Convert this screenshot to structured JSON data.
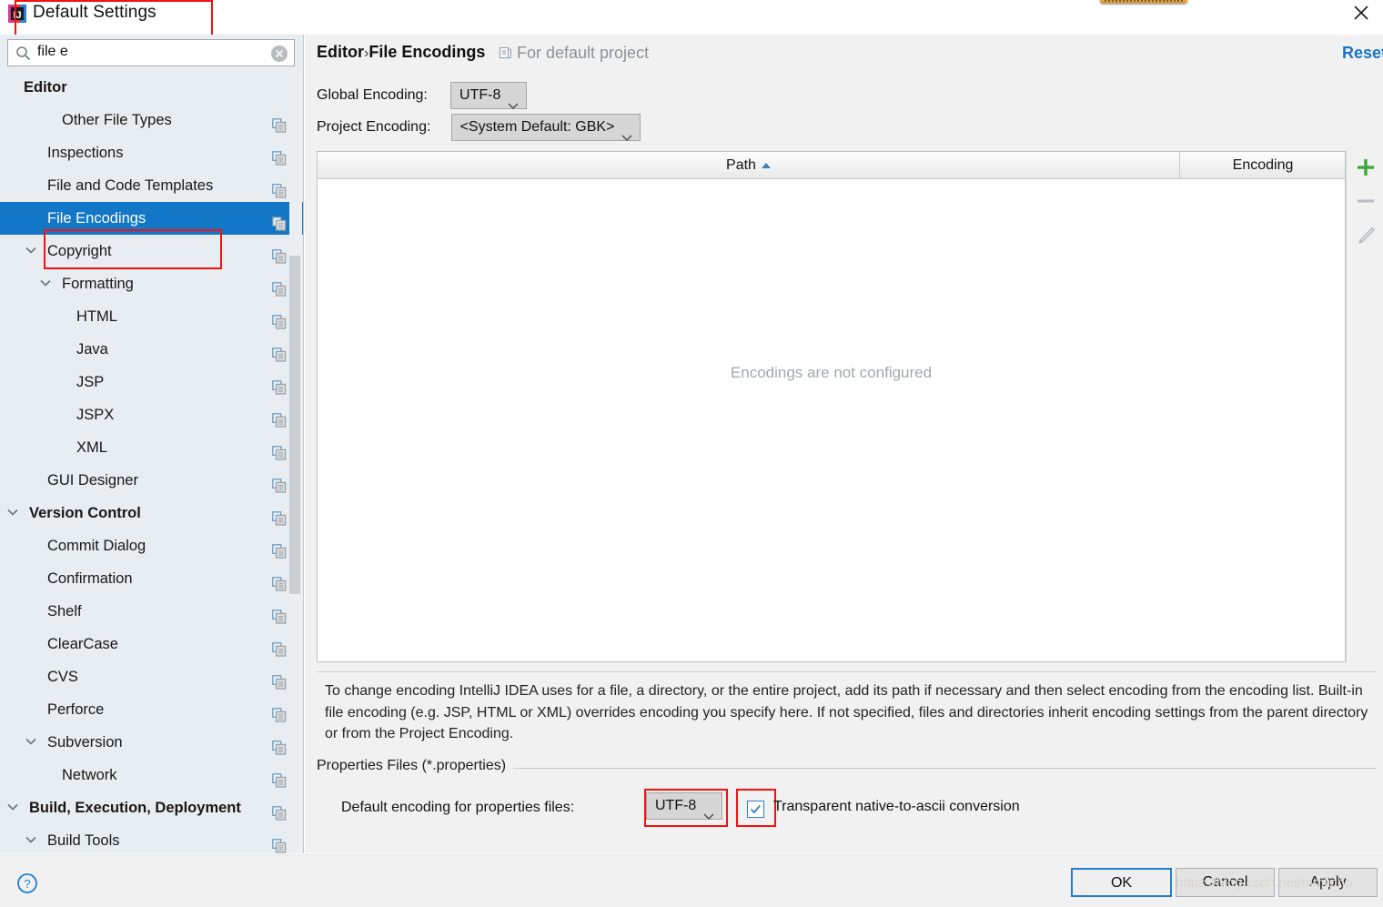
{
  "window": {
    "title": "Default Settings",
    "app_icon": "intellij-idea-icon",
    "close_icon": "close-icon"
  },
  "search": {
    "value": "file e",
    "placeholder": "",
    "icon": "search-icon",
    "clear_icon": "clear-icon"
  },
  "sidebar": {
    "items": [
      {
        "label": "Editor",
        "indent": 26,
        "bold": true,
        "chevron": "none",
        "selected": false,
        "copy": false
      },
      {
        "label": "Other File Types",
        "indent": 68,
        "bold": false,
        "chevron": "none",
        "selected": false,
        "copy": true
      },
      {
        "label": "Inspections",
        "indent": 52,
        "bold": false,
        "chevron": "none",
        "selected": false,
        "copy": true
      },
      {
        "label": "File and Code Templates",
        "indent": 52,
        "bold": false,
        "chevron": "none",
        "selected": false,
        "copy": true
      },
      {
        "label": "File Encodings",
        "indent": 52,
        "bold": false,
        "chevron": "none",
        "selected": true,
        "copy": true
      },
      {
        "label": "Copyright",
        "indent": 52,
        "bold": false,
        "chevron": "down",
        "selected": false,
        "copy": true
      },
      {
        "label": "Formatting",
        "indent": 68,
        "bold": false,
        "chevron": "down",
        "selected": false,
        "copy": true
      },
      {
        "label": "HTML",
        "indent": 84,
        "bold": false,
        "chevron": "none",
        "selected": false,
        "copy": true
      },
      {
        "label": "Java",
        "indent": 84,
        "bold": false,
        "chevron": "none",
        "selected": false,
        "copy": true
      },
      {
        "label": "JSP",
        "indent": 84,
        "bold": false,
        "chevron": "none",
        "selected": false,
        "copy": true
      },
      {
        "label": "JSPX",
        "indent": 84,
        "bold": false,
        "chevron": "none",
        "selected": false,
        "copy": true
      },
      {
        "label": "XML",
        "indent": 84,
        "bold": false,
        "chevron": "none",
        "selected": false,
        "copy": true
      },
      {
        "label": "GUI Designer",
        "indent": 52,
        "bold": false,
        "chevron": "none",
        "selected": false,
        "copy": true
      },
      {
        "label": "Version Control",
        "indent": 32,
        "bold": true,
        "chevron": "down",
        "selected": false,
        "copy": true
      },
      {
        "label": "Commit Dialog",
        "indent": 52,
        "bold": false,
        "chevron": "none",
        "selected": false,
        "copy": true
      },
      {
        "label": "Confirmation",
        "indent": 52,
        "bold": false,
        "chevron": "none",
        "selected": false,
        "copy": true
      },
      {
        "label": "Shelf",
        "indent": 52,
        "bold": false,
        "chevron": "none",
        "selected": false,
        "copy": true
      },
      {
        "label": "ClearCase",
        "indent": 52,
        "bold": false,
        "chevron": "none",
        "selected": false,
        "copy": true
      },
      {
        "label": "CVS",
        "indent": 52,
        "bold": false,
        "chevron": "none",
        "selected": false,
        "copy": true
      },
      {
        "label": "Perforce",
        "indent": 52,
        "bold": false,
        "chevron": "none",
        "selected": false,
        "copy": true
      },
      {
        "label": "Subversion",
        "indent": 52,
        "bold": false,
        "chevron": "down",
        "selected": false,
        "copy": true
      },
      {
        "label": "Network",
        "indent": 68,
        "bold": false,
        "chevron": "none",
        "selected": false,
        "copy": true
      },
      {
        "label": "Build, Execution, Deployment",
        "indent": 32,
        "bold": true,
        "chevron": "down",
        "selected": false,
        "copy": true
      },
      {
        "label": "Build Tools",
        "indent": 52,
        "bold": false,
        "chevron": "down",
        "selected": false,
        "copy": true
      }
    ]
  },
  "main": {
    "breadcrumb_parent": "Editor",
    "breadcrumb_sep": "›",
    "breadcrumb_current": "File Encodings",
    "for_project": "For default project",
    "for_project_icon": "project-scope-icon",
    "reset_label": "Reset",
    "global_encoding_label": "Global Encoding:",
    "global_encoding_value": "UTF-8",
    "project_encoding_label": "Project Encoding:",
    "project_encoding_value": "<System Default: GBK>",
    "table": {
      "columns": [
        "Path",
        "Encoding"
      ],
      "sort_column": "Path",
      "sort_direction": "ascending",
      "rows": [],
      "empty_message": "Encodings are not configured"
    },
    "toolbar": {
      "add_label": "add-row",
      "remove_label": "remove-row",
      "edit_label": "edit-row"
    },
    "description": "To change encoding IntelliJ IDEA uses for a file, a directory, or the entire project, add its path if necessary and then select encoding from the encoding list. Built-in file encoding (e.g. JSP, HTML or XML) overrides encoding you specify here. If not specified, files and directories inherit encoding settings from the parent directory or from the Project Encoding.",
    "properties_group": {
      "title": "Properties Files (*.properties)",
      "default_encoding_label": "Default encoding for properties files:",
      "default_encoding_value": "UTF-8",
      "transparent_label": "Transparent native-to-ascii conversion",
      "transparent_checked": true
    }
  },
  "footer": {
    "help_label": "?",
    "ok_label": "OK",
    "cancel_label": "Cancel",
    "apply_label": "Apply"
  },
  "watermark": "https://blog.csdn.net/mmlicho",
  "colors": {
    "accent_blue": "#1377c7",
    "link_blue": "#1a75c7",
    "highlight_red": "#f50f0f",
    "panel_bg": "#f1f1f1",
    "sidebar_bg": "#e8edf1",
    "add_green": "#3aa83a"
  }
}
